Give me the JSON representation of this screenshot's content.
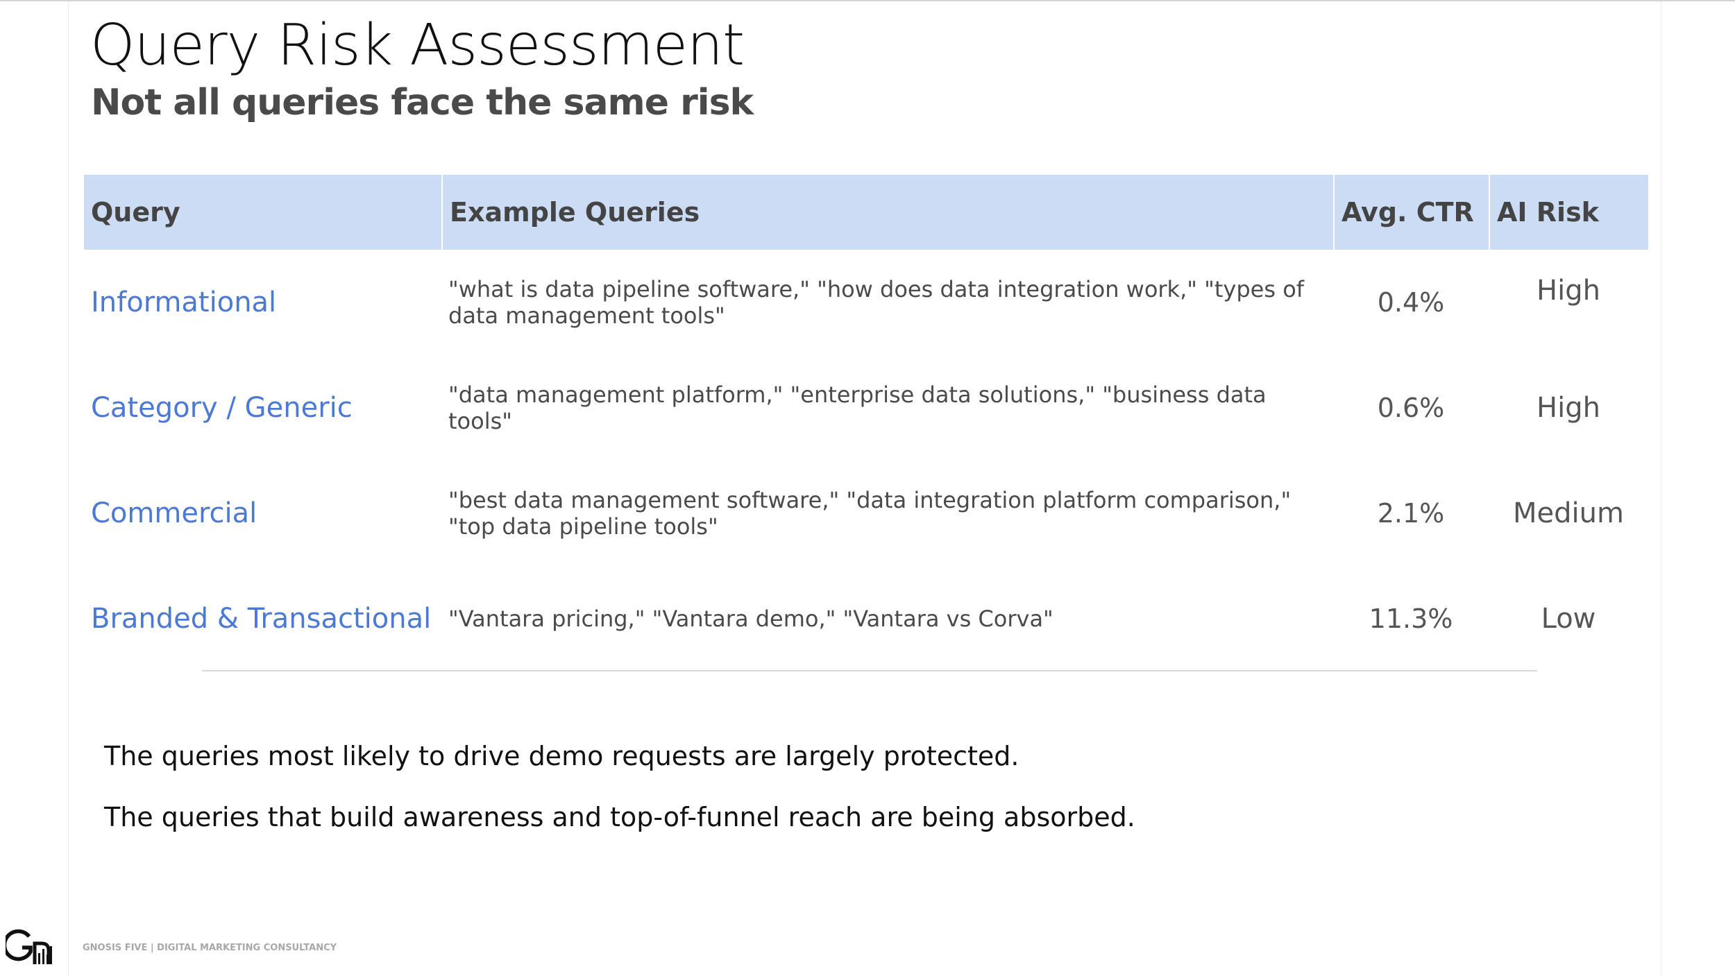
{
  "slide": {
    "title": "Query Risk Assessment",
    "subtitle": "Not all queries face the same risk"
  },
  "table": {
    "headers": {
      "query": "Query",
      "examples": "Example Queries",
      "ctr": "Avg. CTR",
      "risk": "AI Risk"
    },
    "rows": [
      {
        "query": "Informational",
        "examples": "\"what is data pipeline software,\" \"how does data integration work,\" \"types of data management tools\"",
        "ctr": "0.4%",
        "risk": "High"
      },
      {
        "query": "Category / Generic",
        "examples": "\"data management platform,\" \"enterprise data solutions,\" \"business data tools\"",
        "ctr": "0.6%",
        "risk": "High"
      },
      {
        "query": "Commercial",
        "examples": "\"best data management software,\" \"data integration platform comparison,\" \"top data pipeline tools\"",
        "ctr": "2.1%",
        "risk": "Medium"
      },
      {
        "query": "Branded & Transactional",
        "examples": "\"Vantara pricing,\" \"Vantara demo,\" \"Vantara vs Corva\"",
        "ctr": "11.3%",
        "risk": "Low"
      }
    ]
  },
  "takeaways": [
    "The queries most likely to drive demo requests are largely protected.",
    "The queries that build awareness and top-of-funnel reach are being absorbed."
  ],
  "footer": {
    "logo_icon": "gnosis-five-logo",
    "text": "GNOSIS FIVE | DIGITAL MARKETING CONSULTANCY"
  },
  "colors": {
    "header_bg": "#cddcf5",
    "query_accent": "#4b79d6",
    "title": "#111111",
    "subtitle": "#4a4a4a"
  }
}
